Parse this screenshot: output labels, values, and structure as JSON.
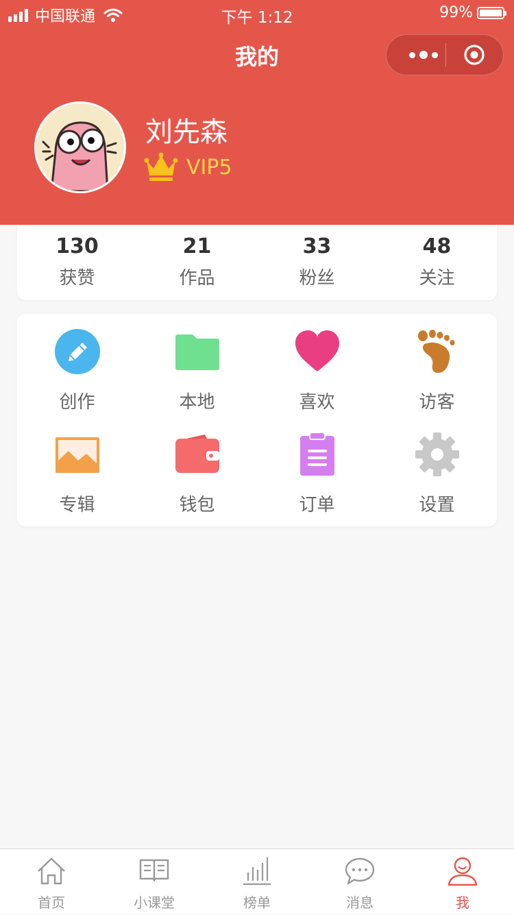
{
  "status_bar": {
    "carrier": "中国联通",
    "time": "下午 1:12",
    "battery_percent": "99%",
    "battery_level": 0.99
  },
  "nav": {
    "title": "我的"
  },
  "profile": {
    "name": "刘先森",
    "vip_level": "VIP5",
    "accent_color": "#e5564a",
    "vip_color": "#ffd54f"
  },
  "stats": [
    {
      "value": "130",
      "label": "获赞"
    },
    {
      "value": "21",
      "label": "作品"
    },
    {
      "value": "33",
      "label": "粉丝"
    },
    {
      "value": "48",
      "label": "关注"
    }
  ],
  "menu": [
    {
      "label": "创作",
      "icon": "pencil-icon",
      "color": "#4bb5ee"
    },
    {
      "label": "本地",
      "icon": "folder-icon",
      "color": "#6ee090"
    },
    {
      "label": "喜欢",
      "icon": "heart-icon",
      "color": "#ea3e82"
    },
    {
      "label": "访客",
      "icon": "footprint-icon",
      "color": "#c97c2c"
    },
    {
      "label": "专辑",
      "icon": "image-icon",
      "color": "#f4a048"
    },
    {
      "label": "钱包",
      "icon": "wallet-icon",
      "color": "#f56b6b"
    },
    {
      "label": "订单",
      "icon": "clipboard-icon",
      "color": "#d57ef0"
    },
    {
      "label": "设置",
      "icon": "gear-icon",
      "color": "#cccccc"
    }
  ],
  "tabbar": [
    {
      "label": "首页",
      "icon": "home-icon",
      "active": false
    },
    {
      "label": "小课堂",
      "icon": "book-icon",
      "active": false
    },
    {
      "label": "榜单",
      "icon": "bar-chart-icon",
      "active": false
    },
    {
      "label": "消息",
      "icon": "chat-icon",
      "active": false
    },
    {
      "label": "我",
      "icon": "user-icon",
      "active": true
    }
  ]
}
